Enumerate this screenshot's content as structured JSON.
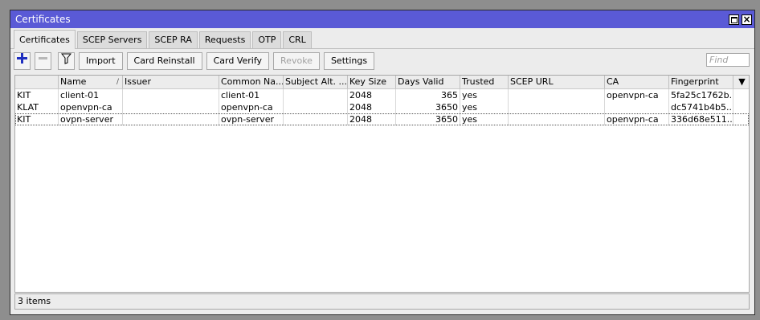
{
  "window": {
    "title": "Certificates"
  },
  "tabs": [
    {
      "label": "Certificates"
    },
    {
      "label": "SCEP Servers"
    },
    {
      "label": "SCEP RA"
    },
    {
      "label": "Requests"
    },
    {
      "label": "OTP"
    },
    {
      "label": "CRL"
    }
  ],
  "toolbar": {
    "add_icon": "plus-icon",
    "remove_icon": "minus-icon",
    "filter_icon": "filter-icon",
    "import": "Import",
    "card_reinstall": "Card Reinstall",
    "card_verify": "Card Verify",
    "revoke": "Revoke",
    "settings": "Settings",
    "find_placeholder": "Find"
  },
  "table": {
    "columns": [
      "",
      "Name",
      "Issuer",
      "Common Na...",
      "Subject Alt. ...",
      "Key Size",
      "Days Valid",
      "Trusted",
      "SCEP URL",
      "CA",
      "Fingerprint"
    ],
    "rows": [
      [
        "KIT",
        "client-01",
        "",
        "client-01",
        "",
        "2048",
        "365",
        "yes",
        "",
        "openvpn-ca",
        "5fa25c1762b..."
      ],
      [
        "KLAT",
        "openvpn-ca",
        "",
        "openvpn-ca",
        "",
        "2048",
        "3650",
        "yes",
        "",
        "",
        "dc5741b4b5..."
      ],
      [
        "KIT",
        "ovpn-server",
        "",
        "ovpn-server",
        "",
        "2048",
        "3650",
        "yes",
        "",
        "openvpn-ca",
        "336d68e511..."
      ]
    ]
  },
  "status": {
    "text": "3 items"
  },
  "colors": {
    "titlebar": "#5a5ad6",
    "add_icon": "#1f2fbf"
  }
}
